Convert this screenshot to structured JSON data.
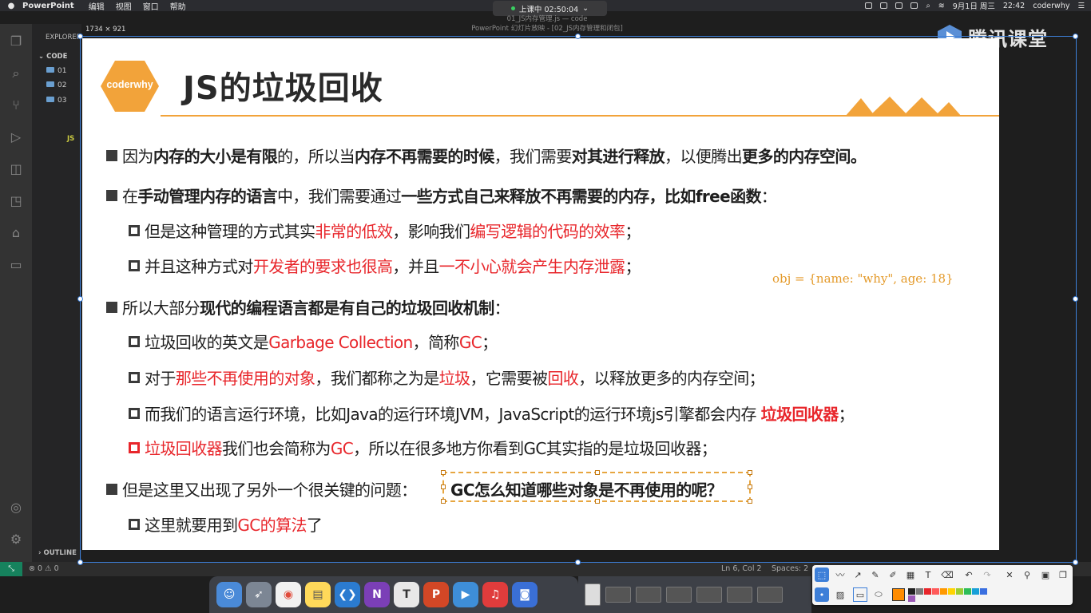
{
  "menubar": {
    "app_name": "PowerPoint",
    "menus": [
      "编辑",
      "视图",
      "窗口",
      "帮助"
    ],
    "date": "9月1日 周三",
    "time": "22:42",
    "user": "coderwhy"
  },
  "session": {
    "status": "上课中 02:50:04",
    "editor_title": "01_JS内存管理.js — code",
    "window_title": "PowerPoint 幻灯片放映 - [02_JS内存管理和闭包]"
  },
  "vscode": {
    "explorer_label": "EXPLORER",
    "section": "CODE",
    "folders": [
      "01",
      "02",
      "03"
    ],
    "file": "JS",
    "outline": "OUTLINE",
    "status_errors": "0",
    "status_warnings": "0",
    "cursor": "Ln 6, Col 2",
    "spaces": "Spaces: 2"
  },
  "overlay": {
    "dimensions": "1734 × 921",
    "brand": "腾讯课堂"
  },
  "slide": {
    "logo": "coderwhy",
    "title": "JS的垃圾回收",
    "b1": {
      "t1": "因为",
      "t2": "内存的大小是有限",
      "t3": "的，所以当",
      "t4": "内存不再需要的时候",
      "t5": "，我们需要",
      "t6": "对其进行释放",
      "t7": "，以便腾出",
      "t8": "更多的内存空间。"
    },
    "b2": {
      "t1": "在",
      "t2": "手动管理内存的语言",
      "t3": "中，我们需要通过",
      "t4": "一些方式自己来释放不再需要的内存，比如free函数",
      "t5": "："
    },
    "b2s1": {
      "t1": "但是这种管理的方式其实",
      "t2": "非常的低效",
      "t3": "，影响我们",
      "t4": "编写逻辑的代码的效率",
      "t5": "；"
    },
    "b2s2": {
      "t1": "并且这种方式对",
      "t2": "开发者的要求也很高",
      "t3": "，并且",
      "t4": "一不小心就会产生内存泄露",
      "t5": "；"
    },
    "code_note": "obj = {name: \"why\", age: 18}",
    "b3": {
      "t1": "所以大部分",
      "t2": "现代的编程语言都是有自己的垃圾回收机制",
      "t3": "："
    },
    "b3s1": {
      "t1": "垃圾回收的英文是",
      "t2": "Garbage Collection",
      "t3": "，简称",
      "t4": "GC",
      "t5": "；"
    },
    "b3s2": {
      "t1": "对于",
      "t2": "那些不再使用的对象",
      "t3": "，我们都称之为是",
      "t4": "垃圾",
      "t5": "，它需要被",
      "t6": "回收",
      "t7": "，以释放更多的内存空间；"
    },
    "b3s3": {
      "t1": "而我们的语言运行环境，比如Java的运行环境JVM，JavaScript的运行环境js引擎都会内存 ",
      "t2": "垃圾回收器",
      "t3": "；"
    },
    "b3s4": {
      "t1": "垃圾回收器",
      "t2": "我们也会简称为",
      "t3": "GC",
      "t4": "，所以在很多地方你看到GC其实指的是垃圾回收器；"
    },
    "b4": {
      "t1": "但是这里又出现了另外一个很关键的问题：",
      "t2": "GC怎么知道哪些对象是不再使用的呢？"
    },
    "b4s1": {
      "t1": "这里就要用到",
      "t2": "GC的算法",
      "t3": "了"
    }
  },
  "colors": {
    "accent_orange": "#f2a33a",
    "highlight_red": "#e8262b",
    "selection_blue": "#3d7fd8",
    "swatches": [
      "#ff8c00",
      "#222222",
      "#7a7a7a",
      "#e8262b",
      "#ff5a5a",
      "#ff9900",
      "#ffd400",
      "#9acd32",
      "#2ebd59",
      "#18a0d8",
      "#3a6fe0",
      "#9b59b6"
    ]
  }
}
